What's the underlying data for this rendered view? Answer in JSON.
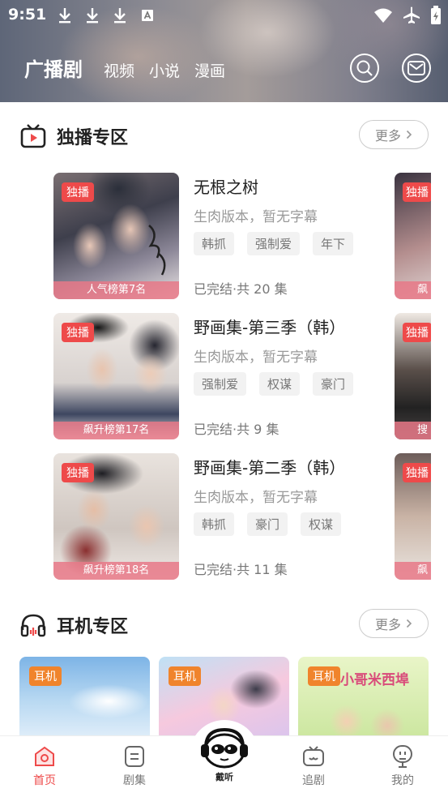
{
  "status_bar": {
    "time": "9:51",
    "left_icons": [
      "download-icon",
      "download-icon",
      "download-icon",
      "font-a-icon"
    ],
    "right_icons": [
      "wifi-icon",
      "airplane-icon",
      "battery-icon"
    ]
  },
  "header": {
    "tabs": [
      {
        "label": "广播剧",
        "active": true
      },
      {
        "label": "视频",
        "active": false
      },
      {
        "label": "小说",
        "active": false
      },
      {
        "label": "漫画",
        "active": false
      }
    ],
    "buttons": [
      "search-icon",
      "mail-icon"
    ]
  },
  "exclusive": {
    "title": "独播专区",
    "more_label": "更多",
    "items": [
      {
        "tag": "独播",
        "rank": "人气榜第7名",
        "title": "无根之树",
        "subtitle": "生肉版本，暂无字幕",
        "chips": [
          "韩抓",
          "强制爱",
          "年下"
        ],
        "status": "已完结·共 20 集"
      },
      {
        "tag": "独播",
        "rank": "飙升榜第17名",
        "title": "野画集-第三季（韩）",
        "subtitle": "生肉版本，暂无字幕",
        "chips": [
          "强制爱",
          "权谋",
          "豪门"
        ],
        "status": "已完结·共 9 集"
      },
      {
        "tag": "独播",
        "rank": "飙升榜第18名",
        "title": "野画集-第二季（韩）",
        "subtitle": "生肉版本，暂无字幕",
        "chips": [
          "韩抓",
          "豪门",
          "权谋"
        ],
        "status": "已完结·共 11 集"
      }
    ],
    "peek": [
      {
        "tag": "独播",
        "rank": "飙"
      },
      {
        "tag": "独播",
        "rank": "搜"
      },
      {
        "tag": "独播",
        "rank": "飙"
      }
    ]
  },
  "headphone": {
    "title": "耳机专区",
    "more_label": "更多",
    "cards": [
      {
        "tag": "耳机"
      },
      {
        "tag": "耳机"
      },
      {
        "tag": "耳机",
        "art_text": "小哥米西埠"
      }
    ]
  },
  "bottom_nav": {
    "items": [
      {
        "label": "首页",
        "icon": "home-icon",
        "active": true
      },
      {
        "label": "剧集",
        "icon": "list-icon",
        "active": false
      },
      {
        "label": "追剧",
        "icon": "tv-icon",
        "active": false
      },
      {
        "label": "我的",
        "icon": "profile-icon",
        "active": false
      }
    ],
    "center_label": "戴听"
  },
  "colors": {
    "accent": "#ee4a4a",
    "rank_bg": "#e87887",
    "ear_tag": "#f0842c"
  }
}
